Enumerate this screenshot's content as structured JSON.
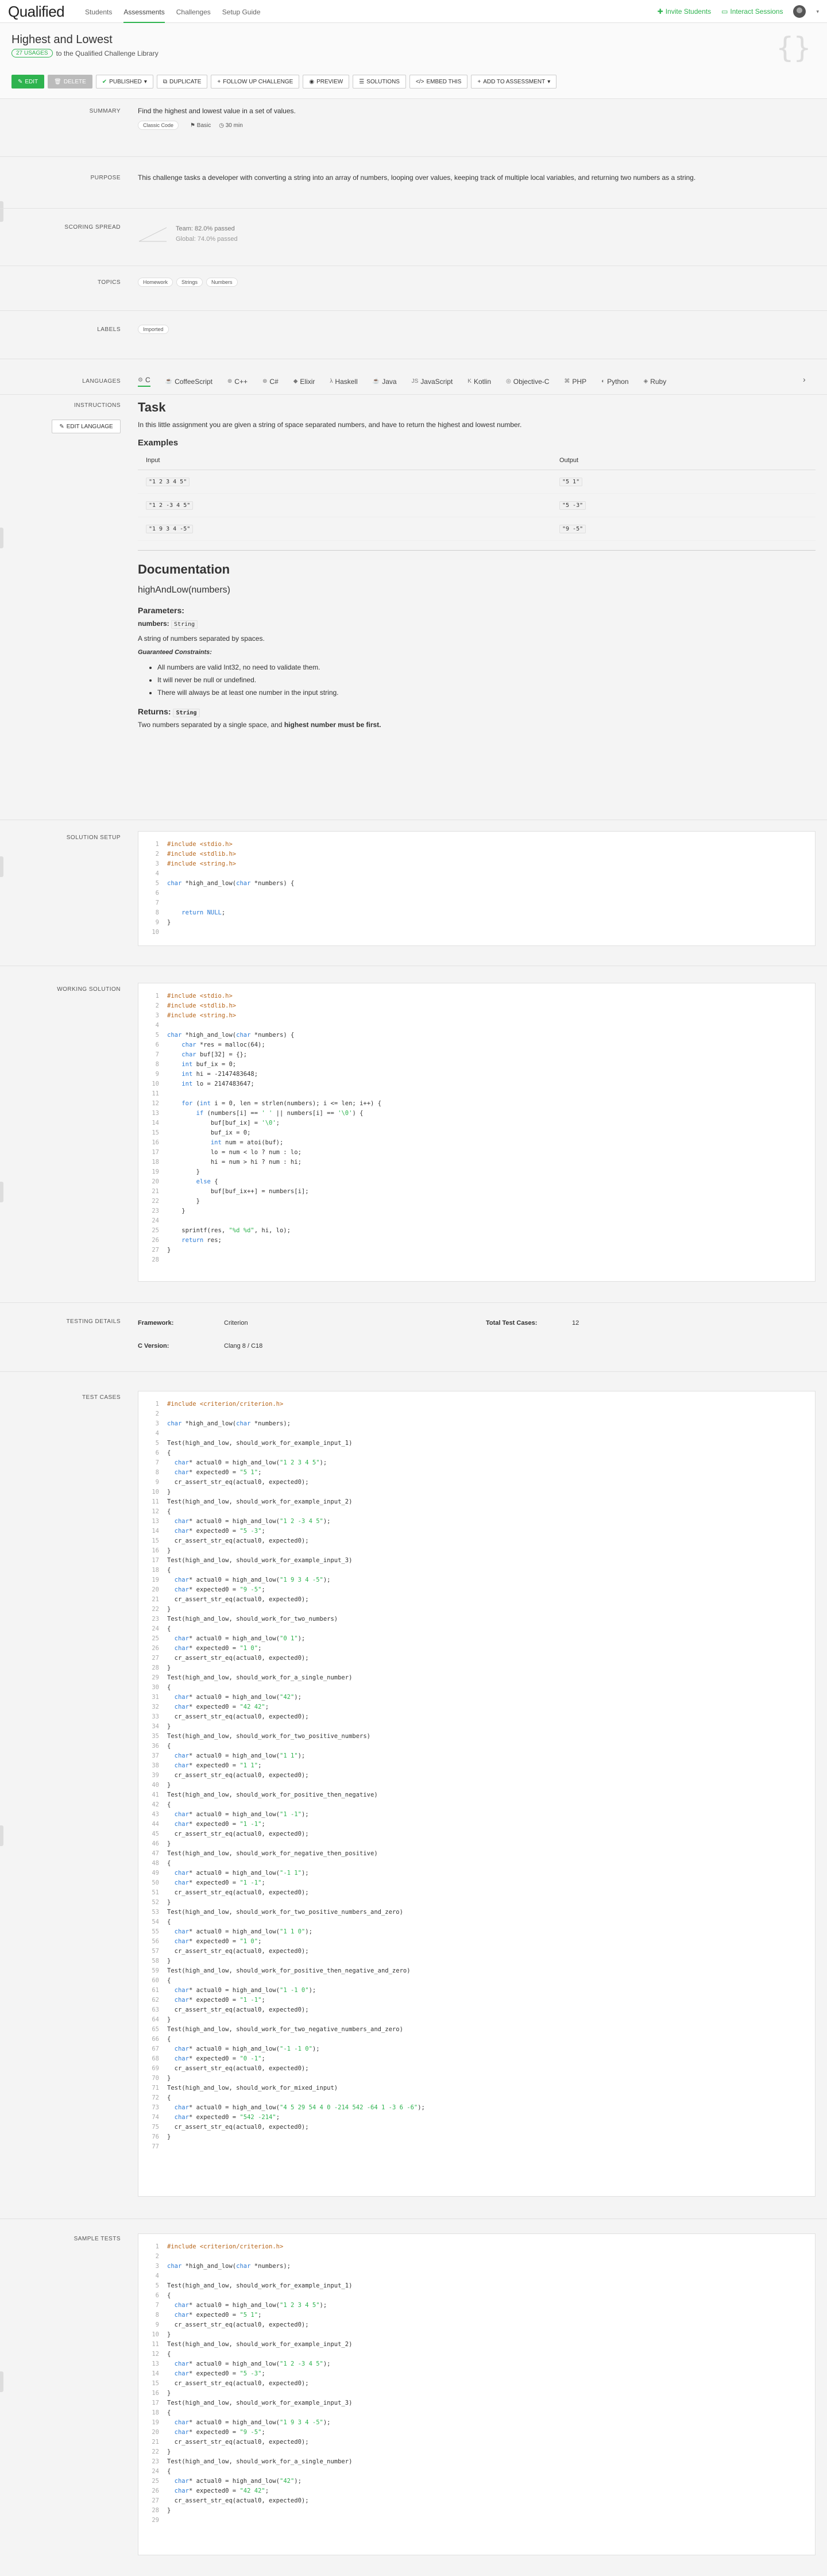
{
  "nav": {
    "logo": "Qualified",
    "links": [
      "Students",
      "Assessments",
      "Challenges",
      "Setup Guide"
    ],
    "active_index": 1,
    "invite": "Invite Students",
    "interact": "Interact Sessions"
  },
  "header": {
    "title": "Highest and Lowest",
    "pill": "27 USAGES",
    "subtitle": "to the Qualified Challenge Library",
    "buttons": [
      "EDIT",
      "DELETE",
      "PUBLISHED",
      "DUPLICATE",
      "FOLLOW UP CHALLENGE",
      "PREVIEW",
      "SOLUTIONS",
      "EMBED THIS",
      "ADD TO ASSESSMENT"
    ]
  },
  "summary": {
    "label": "SUMMARY",
    "text": "Find the highest and lowest value in a set of values.",
    "tags": [
      "Classic Code",
      "Basic",
      "30 min"
    ]
  },
  "purpose": {
    "label": "PURPOSE",
    "text": "This challenge tasks a developer with converting a string into an array of numbers, looping over values, keeping track of multiple local variables, and returning two numbers as a string."
  },
  "scoring": {
    "label": "SCORING SPREAD",
    "team": "Team: 82.0% passed",
    "global": "Global: 74.0% passed"
  },
  "topics": {
    "label": "TOPICS",
    "items": [
      "Homework",
      "Strings",
      "Numbers"
    ]
  },
  "labels": {
    "label": "LABELS",
    "items": [
      "Imported"
    ]
  },
  "languages": {
    "label": "LANGUAGES",
    "items": [
      "C",
      "CoffeeScript",
      "C++",
      "C#",
      "Elixir",
      "Haskell",
      "Java",
      "JavaScript",
      "Kotlin",
      "Objective-C",
      "PHP",
      "Python",
      "Ruby"
    ]
  },
  "instructions": {
    "label": "INSTRUCTIONS",
    "edit_language": "EDIT LANGUAGE",
    "task_title": "Task",
    "task_text": "In this little assignment you are given a string of space separated numbers, and have to return the highest and lowest number.",
    "examples_title": "Examples",
    "col_input": "Input",
    "col_output": "Output",
    "examples": [
      {
        "input": "\"1 2 3 4 5\"",
        "output": "\"5 1\""
      },
      {
        "input": "\"1 2 -3 4 5\"",
        "output": "\"5 -3\""
      },
      {
        "input": "\"1 9 3 4 -5\"",
        "output": "\"9 -5\""
      }
    ],
    "doc_title": "Documentation",
    "fn_sig": "highAndLow(numbers)",
    "params_title": "Parameters:",
    "param_name": "numbers:",
    "param_type": "String",
    "param_desc": "A string of numbers separated by spaces.",
    "constraints_title": "Guaranteed Constraints:",
    "constraints": [
      "All numbers are valid Int32, no need to validate them.",
      "It will never be null or undefined.",
      "There will always be at least one number in the input string."
    ],
    "returns_title": "Returns:",
    "returns_type": "String",
    "returns_desc_a": "Two numbers separated by a single space, and ",
    "returns_desc_b": "highest number must be first."
  },
  "solution_setup": {
    "label": "SOLUTION SETUP",
    "lines": [
      "#include <stdio.h>",
      "#include <stdlib.h>",
      "#include <string.h>",
      "",
      "char *high_and_low(char *numbers) {",
      "",
      "",
      "    return NULL;",
      "}",
      ""
    ]
  },
  "working_solution": {
    "label": "WORKING SOLUTION",
    "lines": [
      "#include <stdio.h>",
      "#include <stdlib.h>",
      "#include <string.h>",
      "",
      "char *high_and_low(char *numbers) {",
      "    char *res = malloc(64);",
      "    char buf[32] = {};",
      "    int buf_ix = 0;",
      "    int hi = -2147483648;",
      "    int lo = 2147483647;",
      "",
      "    for (int i = 0, len = strlen(numbers); i <= len; i++) {",
      "        if (numbers[i] == ' ' || numbers[i] == '\\0') {",
      "            buf[buf_ix] = '\\0';",
      "            buf_ix = 0;",
      "            int num = atoi(buf);",
      "            lo = num < lo ? num : lo;",
      "            hi = num > hi ? num : hi;",
      "        }",
      "        else {",
      "            buf[buf_ix++] = numbers[i];",
      "        }",
      "    }",
      "",
      "    sprintf(res, \"%d %d\", hi, lo);",
      "    return res;",
      "}",
      ""
    ]
  },
  "testing_details": {
    "label": "TESTING DETAILS",
    "framework_label": "Framework:",
    "framework": "Criterion",
    "total_label": "Total Test Cases:",
    "total": "12",
    "cver_label": "C Version:",
    "cver": "Clang 8 / C18"
  },
  "test_cases": {
    "label": "TEST CASES",
    "lines": [
      "#include <criterion/criterion.h>",
      "",
      "char *high_and_low(char *numbers);",
      "",
      "Test(high_and_low, should_work_for_example_input_1)",
      "{",
      "  char* actual0 = high_and_low(\"1 2 3 4 5\");",
      "  char* expected0 = \"5 1\";",
      "  cr_assert_str_eq(actual0, expected0);",
      "}",
      "Test(high_and_low, should_work_for_example_input_2)",
      "{",
      "  char* actual0 = high_and_low(\"1 2 -3 4 5\");",
      "  char* expected0 = \"5 -3\";",
      "  cr_assert_str_eq(actual0, expected0);",
      "}",
      "Test(high_and_low, should_work_for_example_input_3)",
      "{",
      "  char* actual0 = high_and_low(\"1 9 3 4 -5\");",
      "  char* expected0 = \"9 -5\";",
      "  cr_assert_str_eq(actual0, expected0);",
      "}",
      "Test(high_and_low, should_work_for_two_numbers)",
      "{",
      "  char* actual0 = high_and_low(\"0 1\");",
      "  char* expected0 = \"1 0\";",
      "  cr_assert_str_eq(actual0, expected0);",
      "}",
      "Test(high_and_low, should_work_for_a_single_number)",
      "{",
      "  char* actual0 = high_and_low(\"42\");",
      "  char* expected0 = \"42 42\";",
      "  cr_assert_str_eq(actual0, expected0);",
      "}",
      "Test(high_and_low, should_work_for_two_positive_numbers)",
      "{",
      "  char* actual0 = high_and_low(\"1 1\");",
      "  char* expected0 = \"1 1\";",
      "  cr_assert_str_eq(actual0, expected0);",
      "}",
      "Test(high_and_low, should_work_for_positive_then_negative)",
      "{",
      "  char* actual0 = high_and_low(\"1 -1\");",
      "  char* expected0 = \"1 -1\";",
      "  cr_assert_str_eq(actual0, expected0);",
      "}",
      "Test(high_and_low, should_work_for_negative_then_positive)",
      "{",
      "  char* actual0 = high_and_low(\"-1 1\");",
      "  char* expected0 = \"1 -1\";",
      "  cr_assert_str_eq(actual0, expected0);",
      "}",
      "Test(high_and_low, should_work_for_two_positive_numbers_and_zero)",
      "{",
      "  char* actual0 = high_and_low(\"1 1 0\");",
      "  char* expected0 = \"1 0\";",
      "  cr_assert_str_eq(actual0, expected0);",
      "}",
      "Test(high_and_low, should_work_for_positive_then_negative_and_zero)",
      "{",
      "  char* actual0 = high_and_low(\"1 -1 0\");",
      "  char* expected0 = \"1 -1\";",
      "  cr_assert_str_eq(actual0, expected0);",
      "}",
      "Test(high_and_low, should_work_for_two_negative_numbers_and_zero)",
      "{",
      "  char* actual0 = high_and_low(\"-1 -1 0\");",
      "  char* expected0 = \"0 -1\";",
      "  cr_assert_str_eq(actual0, expected0);",
      "}",
      "Test(high_and_low, should_work_for_mixed_input)",
      "{",
      "  char* actual0 = high_and_low(\"4 5 29 54 4 0 -214 542 -64 1 -3 6 -6\");",
      "  char* expected0 = \"542 -214\";",
      "  cr_assert_str_eq(actual0, expected0);",
      "}",
      ""
    ]
  },
  "sample_tests": {
    "label": "SAMPLE TESTS",
    "lines": [
      "#include <criterion/criterion.h>",
      "",
      "char *high_and_low(char *numbers);",
      "",
      "Test(high_and_low, should_work_for_example_input_1)",
      "{",
      "  char* actual0 = high_and_low(\"1 2 3 4 5\");",
      "  char* expected0 = \"5 1\";",
      "  cr_assert_str_eq(actual0, expected0);",
      "}",
      "Test(high_and_low, should_work_for_example_input_2)",
      "{",
      "  char* actual0 = high_and_low(\"1 2 -3 4 5\");",
      "  char* expected0 = \"5 -3\";",
      "  cr_assert_str_eq(actual0, expected0);",
      "}",
      "Test(high_and_low, should_work_for_example_input_3)",
      "{",
      "  char* actual0 = high_and_low(\"1 9 3 4 -5\");",
      "  char* expected0 = \"9 -5\";",
      "  cr_assert_str_eq(actual0, expected0);",
      "}",
      "Test(high_and_low, should_work_for_a_single_number)",
      "{",
      "  char* actual0 = high_and_low(\"42\");",
      "  char* expected0 = \"42 42\";",
      "  cr_assert_str_eq(actual0, expected0);",
      "}",
      ""
    ]
  },
  "colors": {
    "accent": "#2eb34f",
    "keyword": "#2b7bd6",
    "string": "#2eb34f",
    "preproc": "#b8661b"
  }
}
